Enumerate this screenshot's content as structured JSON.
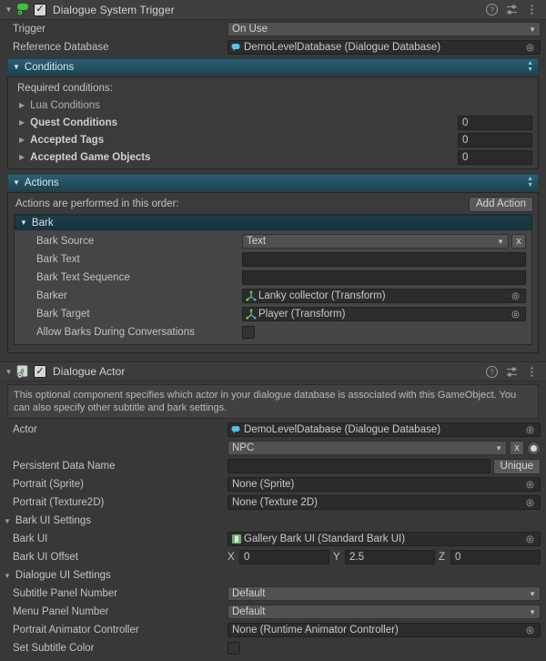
{
  "trigger_component": {
    "title": "Dialogue System Trigger",
    "icon": "dialogue-system-component-icon",
    "enabled_check": "✓",
    "header_icons": [
      "help-icon",
      "preset-icon",
      "more-menu-icon"
    ],
    "rows": [
      {
        "label": "Trigger",
        "type": "dropdown",
        "value": "On Use"
      },
      {
        "label": "Reference Database",
        "type": "object",
        "value": "DemoLevelDatabase (Dialogue Database)",
        "icon": "dialogue-database-icon"
      }
    ],
    "conditions": {
      "section_label": "Conditions",
      "required_label": "Required conditions:",
      "items": [
        {
          "label": "Lua Conditions",
          "bold": false,
          "count": null
        },
        {
          "label": "Quest Conditions",
          "bold": true,
          "count": "0"
        },
        {
          "label": "Accepted Tags",
          "bold": true,
          "count": "0"
        },
        {
          "label": "Accepted Game Objects",
          "bold": true,
          "count": "0"
        }
      ]
    },
    "actions": {
      "section_label": "Actions",
      "order_note": "Actions are performed in this order:",
      "add_button": "Add Action",
      "bark": {
        "title": "Bark",
        "rows": [
          {
            "label": "Bark Source",
            "type": "dropdown",
            "value": "Text",
            "extra": "x"
          },
          {
            "label": "Bark Text",
            "type": "text",
            "value": ""
          },
          {
            "label": "Bark Text Sequence",
            "type": "text",
            "value": ""
          },
          {
            "label": "Barker",
            "type": "object",
            "value": "Lanky collector (Transform)",
            "icon": "transform-icon"
          },
          {
            "label": "Bark Target",
            "type": "object",
            "value": "Player (Transform)",
            "icon": "transform-icon"
          },
          {
            "label": "Allow Barks During Conversations",
            "type": "checkbox",
            "value": ""
          }
        ]
      }
    }
  },
  "actor_component": {
    "title": "Dialogue Actor",
    "icon": "csharp-script-icon",
    "enabled_check": "✓",
    "header_icons": [
      "help-icon",
      "preset-icon",
      "more-menu-icon"
    ],
    "help_text": "This optional component specifies which actor in your dialogue database is associated with this GameObject. You can also specify other subtitle and bark settings.",
    "actor": {
      "label": "Actor",
      "database": "DemoLevelDatabase (Dialogue Database)",
      "database_icon": "dialogue-database-icon",
      "selected_actor": "NPC",
      "clear_button": "x"
    },
    "persistent": {
      "label": "Persistent Data Name",
      "value": "",
      "button": "Unique"
    },
    "portraits": [
      {
        "label": "Portrait (Sprite)",
        "value": "None (Sprite)"
      },
      {
        "label": "Portrait (Texture2D)",
        "value": "None (Texture 2D)"
      }
    ],
    "bark_ui_settings": {
      "label": "Bark UI Settings",
      "bark_ui": {
        "label": "Bark UI",
        "value": "Gallery Bark UI (Standard Bark UI)",
        "icon": "prefab-icon"
      },
      "offset": {
        "label": "Bark UI Offset",
        "x_axis": "X",
        "x": "0",
        "y_axis": "Y",
        "y": "2.5",
        "z_axis": "Z",
        "z": "0"
      }
    },
    "dialogue_ui_settings": {
      "label": "Dialogue UI Settings",
      "rows": [
        {
          "label": "Subtitle Panel Number",
          "type": "dropdown",
          "value": "Default"
        },
        {
          "label": "Menu Panel Number",
          "type": "dropdown",
          "value": "Default"
        },
        {
          "label": "Portrait Animator Controller",
          "type": "object",
          "value": "None (Runtime Animator Controller)"
        },
        {
          "label": "Set Subtitle Color",
          "type": "checkbox",
          "value": ""
        }
      ]
    }
  },
  "theme": {
    "bg": "#383838",
    "header_bg": "#3f3f3f",
    "section_teal": "#24546a",
    "field_bg": "#2a2a2a",
    "button_bg": "#585858",
    "text": "#c4c4c4"
  }
}
